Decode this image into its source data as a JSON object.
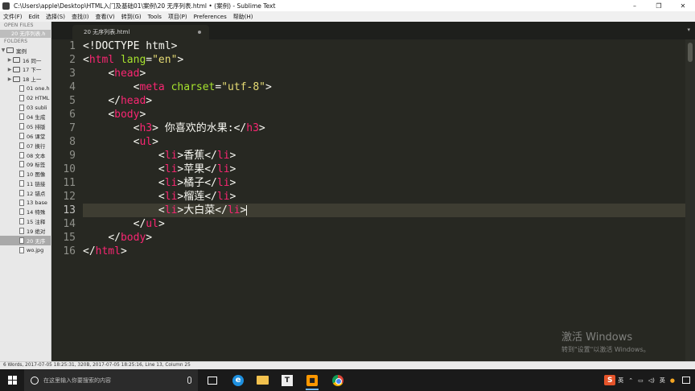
{
  "window": {
    "title": "C:\\Users\\apple\\Desktop\\HTML入门及基础01\\案例\\20 无序列表.html • (案例) - Sublime Text",
    "controls": [
      "–",
      "❐",
      "✕"
    ]
  },
  "menu": [
    "文件(F)",
    "Edit",
    "选择(S)",
    "查找(I)",
    "查看(V)",
    "转到(G)",
    "Tools",
    "项目(P)",
    "Preferences",
    "帮助(H)"
  ],
  "sidebar": {
    "open_files_heading": "OPEN FILES",
    "open_file": "20 无序列表.h",
    "folders_heading": "FOLDERS",
    "root_folder": "案例",
    "subfolders": [
      "16 同一",
      "17 下一",
      "18 上一"
    ],
    "files": [
      "01 one.h",
      "02 HTML",
      "03 subli",
      "04 生成",
      "05 排版",
      "06 课堂",
      "07 换行",
      "08 文本",
      "09 标签",
      "10 图像",
      "11 链接",
      "12 锚点",
      "13 base",
      "14 特殊",
      "15 注释",
      "19 绝对",
      "20 无序",
      "wo.jpg"
    ],
    "selected_file": "20 无序"
  },
  "tab": {
    "label": "20 无序列表.html"
  },
  "editor": {
    "current_line": 13,
    "line_numbers": [
      "1",
      "2",
      "3",
      "4",
      "5",
      "6",
      "7",
      "8",
      "9",
      "10",
      "11",
      "12",
      "13",
      "14",
      "15",
      "16"
    ],
    "lines": [
      [
        [
          "p",
          "<!DOCTYPE html>"
        ]
      ],
      [
        [
          "p",
          "<"
        ],
        [
          "t",
          "html"
        ],
        [
          "p",
          " "
        ],
        [
          "a",
          "lang"
        ],
        [
          "p",
          "="
        ],
        [
          "s",
          "\"en\""
        ],
        [
          "p",
          ">"
        ]
      ],
      [
        [
          "i",
          "    "
        ],
        [
          "p",
          "<"
        ],
        [
          "t",
          "head"
        ],
        [
          "p",
          ">"
        ]
      ],
      [
        [
          "i",
          "        "
        ],
        [
          "p",
          "<"
        ],
        [
          "t",
          "meta"
        ],
        [
          "p",
          " "
        ],
        [
          "a",
          "charset"
        ],
        [
          "p",
          "="
        ],
        [
          "s",
          "\"utf-8\""
        ],
        [
          "p",
          ">"
        ]
      ],
      [
        [
          "i",
          "    "
        ],
        [
          "p",
          "</"
        ],
        [
          "t",
          "head"
        ],
        [
          "p",
          ">"
        ]
      ],
      [
        [
          "i",
          "    "
        ],
        [
          "p",
          "<"
        ],
        [
          "t",
          "body"
        ],
        [
          "p",
          ">"
        ]
      ],
      [
        [
          "i",
          "        "
        ],
        [
          "p",
          "<"
        ],
        [
          "t",
          "h3"
        ],
        [
          "p",
          "> 你喜欢的水果:</"
        ],
        [
          "t",
          "h3"
        ],
        [
          "p",
          ">"
        ]
      ],
      [
        [
          "i",
          "        "
        ],
        [
          "p",
          "<"
        ],
        [
          "t",
          "ul"
        ],
        [
          "p",
          ">"
        ]
      ],
      [
        [
          "i",
          "            "
        ],
        [
          "p",
          "<"
        ],
        [
          "t",
          "li"
        ],
        [
          "p",
          ">香蕉</"
        ],
        [
          "t",
          "li"
        ],
        [
          "p",
          ">"
        ]
      ],
      [
        [
          "i",
          "            "
        ],
        [
          "p",
          "<"
        ],
        [
          "t",
          "li"
        ],
        [
          "p",
          ">苹果</"
        ],
        [
          "t",
          "li"
        ],
        [
          "p",
          ">"
        ]
      ],
      [
        [
          "i",
          "            "
        ],
        [
          "p",
          "<"
        ],
        [
          "t",
          "li"
        ],
        [
          "p",
          ">橘子</"
        ],
        [
          "t",
          "li"
        ],
        [
          "p",
          ">"
        ]
      ],
      [
        [
          "i",
          "            "
        ],
        [
          "p",
          "<"
        ],
        [
          "t",
          "li"
        ],
        [
          "p",
          ">榴莲</"
        ],
        [
          "t",
          "li"
        ],
        [
          "p",
          ">"
        ]
      ],
      [
        [
          "i",
          "            "
        ],
        [
          "p",
          "<"
        ],
        [
          "t",
          "li"
        ],
        [
          "p",
          ">大白菜</"
        ],
        [
          "t",
          "li"
        ],
        [
          "p",
          ">"
        ],
        [
          "c",
          ""
        ]
      ],
      [
        [
          "i",
          "        "
        ],
        [
          "p",
          "</"
        ],
        [
          "t",
          "ul"
        ],
        [
          "p",
          ">"
        ]
      ],
      [
        [
          "i",
          "    "
        ],
        [
          "p",
          "</"
        ],
        [
          "t",
          "body"
        ],
        [
          "p",
          ">"
        ]
      ],
      [
        [
          "p",
          "</"
        ],
        [
          "t",
          "html"
        ],
        [
          "p",
          ">"
        ]
      ]
    ]
  },
  "status_bar": {
    "text": "6 Words, 2017-07-05 18:25:31, 320B, 2017-07-05 18:25:16, Line 13, Column 25"
  },
  "watermark": {
    "line1": "激活 Windows",
    "line2": "转到\"设置\"以激活 Windows。"
  },
  "taskbar": {
    "search_placeholder": "在这里输入你要搜索的内容",
    "tray": {
      "ime_glyph": "S",
      "lang": "英",
      "ime_mode": "英"
    }
  },
  "colors": {
    "editor_bg": "#272822",
    "tag": "#f92672",
    "attr": "#a6e22e",
    "string": "#e6db74",
    "text": "#f8f8f2",
    "line_number": "#8f908a"
  }
}
